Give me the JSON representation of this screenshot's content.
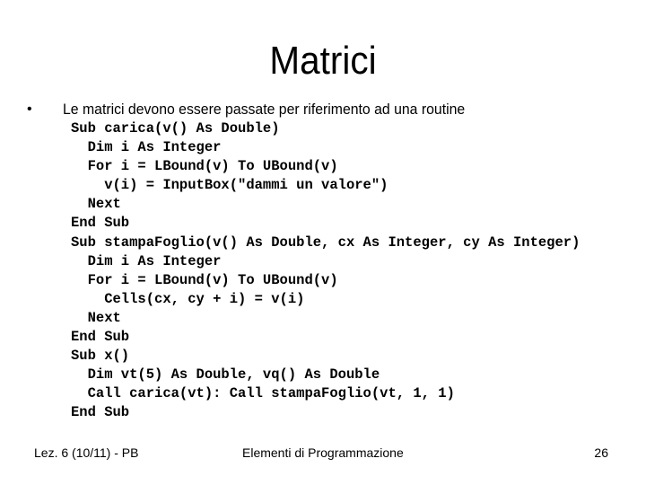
{
  "slide": {
    "title": "Matrici",
    "bullet": {
      "marker": "•",
      "text": "Le matrici devono essere passate per riferimento ad una routine"
    },
    "code_lines": [
      "Sub carica(v() As Double)",
      "  Dim i As Integer",
      "  For i = LBound(v) To UBound(v)",
      "    v(i) = InputBox(\"dammi un valore\")",
      "  Next",
      "End Sub",
      "Sub stampaFoglio(v() As Double, cx As Integer, cy As Integer)",
      "  Dim i As Integer",
      "  For i = LBound(v) To UBound(v)",
      "    Cells(cx, cy + i) = v(i)",
      "  Next",
      "End Sub",
      "Sub x()",
      "  Dim vt(5) As Double, vq() As Double",
      "  Call carica(vt): Call stampaFoglio(vt, 1, 1)",
      "End Sub"
    ]
  },
  "footer": {
    "left": "Lez. 6 (10/11) - PB",
    "center": "Elementi di Programmazione",
    "page_number": "26"
  }
}
